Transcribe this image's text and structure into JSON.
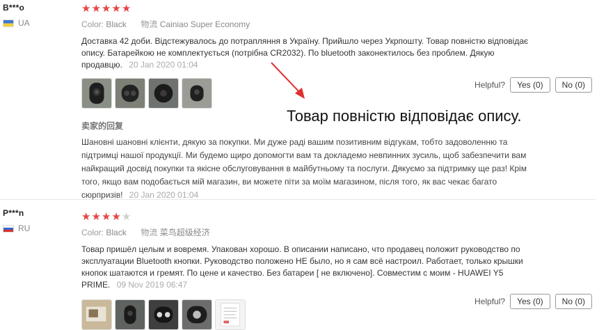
{
  "reviews": [
    {
      "user": "B***o",
      "country": "UA",
      "rating": 5,
      "color_label": "Color:",
      "color_value": "Black",
      "shipping_label": "物流",
      "shipping_value": "Cainiao Super Economy",
      "text": "Доставка 42 доби. Відстежувалось до потрапляння в Україну. Прийшло через Укрпошту. Товар повністю відповідає опису. Батарейкою не комплектується (потрібна CR2032). По bluetooth законектилось без проблем. Дякую продавцю.",
      "date": "20 Jan 2020 01:04",
      "photos": [
        "remote-photo-1",
        "remote-photo-2",
        "remote-photo-3",
        "remote-photo-4"
      ],
      "helpful_label": "Helpful?",
      "yes_label": "Yes (0)",
      "no_label": "No (0)",
      "seller_reply_title": "卖家的回复",
      "seller_reply": "Шановні шановні клієнти, дякую за покупки. Ми дуже раді вашим позитивним відгукам, тобто задоволенню та підтримці нашої продукції. Ми будемо щиро допомогти вам та докладемо невпинних зусиль, щоб забезпечити вам найкращий досвід покупки та якісне обслуговування в майбутньому та послуги. Дякуємо за підтримку ще раз! Крім того, якщо вам подобається мій магазин, ви можете піти за моїм магазином, після того, як вас чекає багато сюрпризів!",
      "seller_reply_date": "20 Jan 2020 01:04"
    },
    {
      "user": "P***n",
      "country": "RU",
      "rating": 4,
      "color_label": "Color:",
      "color_value": "Black",
      "shipping_label": "物流",
      "shipping_value": "菜鸟超级经济",
      "text": "Товар пришёл целым и вовремя. Упакован хорошо. В описании написано, что продавец положит руководство по эксплуатации Bluetooth кнопки. Руководство положено НЕ было, но я сам всё настроил. Работает, только крышки кнопок шатаются и гремят. По цене и качество. Без батареи [ не включено]. Совместим с моим - HUAWEI Y5 PRIME.",
      "date": "09 Nov 2019 06:47",
      "photos": [
        "package-photo",
        "remote-photo-5",
        "remote-photo-6",
        "remote-photo-7",
        "manual-photo"
      ],
      "helpful_label": "Helpful?",
      "yes_label": "Yes (0)",
      "no_label": "No (0)"
    }
  ],
  "annotation": {
    "text": "Товар повністю відповідає опису."
  },
  "colors": {
    "star": "#e64545",
    "star_empty": "#cfcfcf",
    "arrow": "#e03030"
  }
}
